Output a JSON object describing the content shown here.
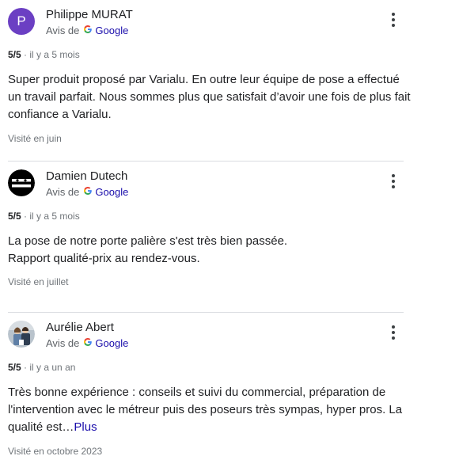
{
  "reviews": [
    {
      "author": "Philippe MURAT",
      "avatar_letter": "P",
      "avatar_color": "#6b3fc3",
      "source_prefix": "Avis de",
      "source_name": "Google",
      "rating": "5/5",
      "age": "il y a 5 mois",
      "text": "Super produit proposé par Varialu. En outre leur équipe de pose a effectué un travail parfait. Nous sommes plus que satisfait d’avoir une fois de plus fait confiance a Varialu.",
      "visited": "Visité en juin"
    },
    {
      "author": "Damien Dutech",
      "avatar_icon": "mask-face-icon",
      "source_prefix": "Avis de",
      "source_name": "Google",
      "rating": "5/5",
      "age": "il y a 5 mois",
      "text_line1": "La pose de notre porte palière s'est très bien passée.",
      "text_line2": "Rapport qualité-prix au rendez-vous.",
      "visited": "Visité en juillet"
    },
    {
      "author": "Aurélie Abert",
      "avatar_icon": "couple-photo-icon",
      "source_prefix": "Avis de",
      "source_name": "Google",
      "rating": "5/5",
      "age": "il y a un an",
      "text": "Très bonne expérience : conseils et suivi du commercial, préparation de l'intervention avec le métreur puis des poseurs très sympas, hyper pros. La qualité est…",
      "more_label": "Plus",
      "visited": "Visité en octobre 2023"
    }
  ],
  "separator": "·",
  "colors": {
    "link": "#1a0dab",
    "muted": "#70757a",
    "text": "#202124"
  }
}
